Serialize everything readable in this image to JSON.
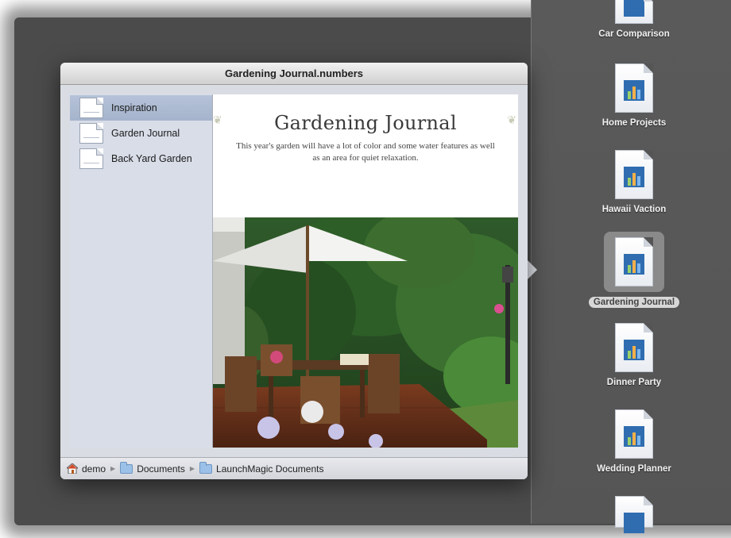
{
  "window": {
    "title": "Gardening Journal.numbers"
  },
  "sheets": [
    {
      "label": "Inspiration",
      "selected": true
    },
    {
      "label": "Garden Journal",
      "selected": false
    },
    {
      "label": "Back Yard Garden",
      "selected": false
    }
  ],
  "preview": {
    "title": "Gardening Journal",
    "subtitle": "This year's garden will have a lot of color and some water features as well as an area for quiet relaxation."
  },
  "path": {
    "segments": [
      "demo",
      "Documents",
      "LaunchMagic Documents"
    ],
    "icons": [
      "house-icon",
      "folder-icon",
      "folder-icon"
    ]
  },
  "documents": [
    {
      "label": "Car Comparison",
      "selected": false
    },
    {
      "label": "Home Projects",
      "selected": false
    },
    {
      "label": "Hawaii Vaction",
      "selected": false
    },
    {
      "label": "Gardening Journal",
      "selected": true
    },
    {
      "label": "Dinner Party",
      "selected": false
    },
    {
      "label": "Wedding Planner",
      "selected": false
    }
  ],
  "colors": {
    "backdrop": "#4b4b4b",
    "selection": "#a5b4cc",
    "icon_accent": "#2f6db0"
  }
}
